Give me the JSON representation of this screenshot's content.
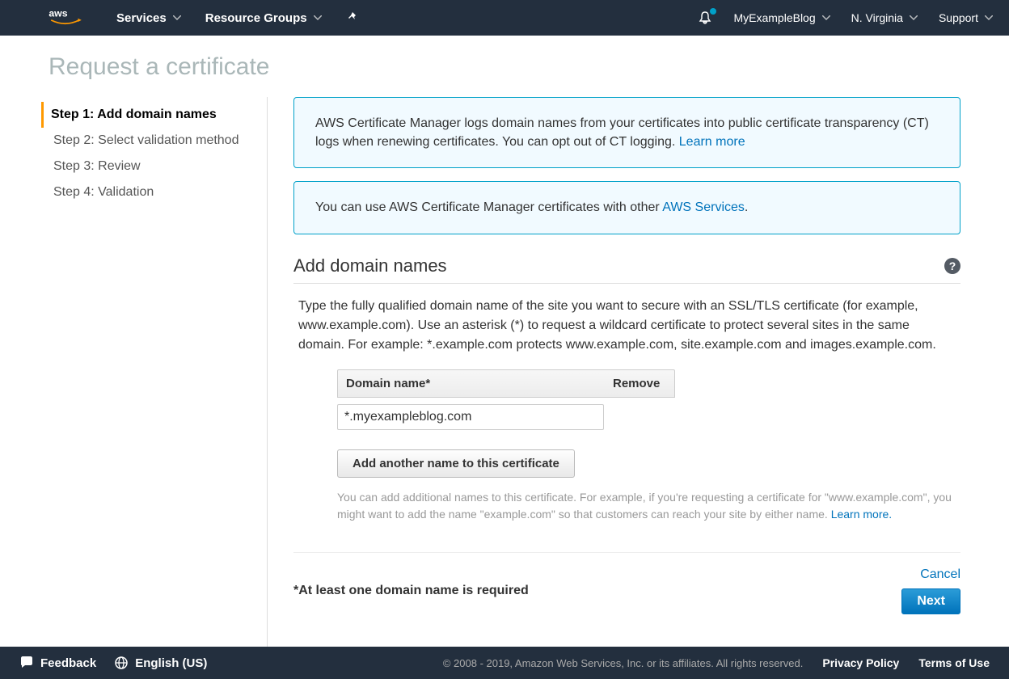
{
  "topnav": {
    "services": "Services",
    "resource_groups": "Resource Groups",
    "account": "MyExampleBlog",
    "region": "N. Virginia",
    "support": "Support"
  },
  "page": {
    "title": "Request a certificate"
  },
  "steps": [
    {
      "label": "Step 1: Add domain names",
      "active": true
    },
    {
      "label": "Step 2: Select validation method",
      "active": false
    },
    {
      "label": "Step 3: Review",
      "active": false
    },
    {
      "label": "Step 4: Validation",
      "active": false
    }
  ],
  "info1": {
    "text": "AWS Certificate Manager logs domain names from your certificates into public certificate transparency (CT) logs when renewing certificates. You can opt out of CT logging. ",
    "link": "Learn more"
  },
  "info2": {
    "text": "You can use AWS Certificate Manager certificates with other ",
    "link": "AWS Services",
    "suffix": "."
  },
  "section": {
    "title": "Add domain names",
    "desc": "Type the fully qualified domain name of the site you want to secure with an SSL/TLS certificate (for example, www.example.com). Use an asterisk (*) to request a wildcard certificate to protect several sites in the same domain. For example: *.example.com protects www.example.com, site.example.com and images.example.com."
  },
  "table": {
    "col_domain": "Domain name*",
    "col_remove": "Remove",
    "value": "*.myexampleblog.com"
  },
  "buttons": {
    "add_another": "Add another name to this certificate",
    "cancel": "Cancel",
    "next": "Next"
  },
  "hints": {
    "additional": "You can add additional names to this certificate. For example, if you're requesting a certificate for \"www.example.com\", you might want to add the name \"example.com\" so that customers can reach your site by either name. ",
    "learn_more": "Learn more."
  },
  "required_note": "*At least one domain name is required",
  "footer": {
    "feedback": "Feedback",
    "language": "English (US)",
    "copyright": "© 2008 - 2019, Amazon Web Services, Inc. or its affiliates. All rights reserved.",
    "privacy": "Privacy Policy",
    "terms": "Terms of Use"
  }
}
